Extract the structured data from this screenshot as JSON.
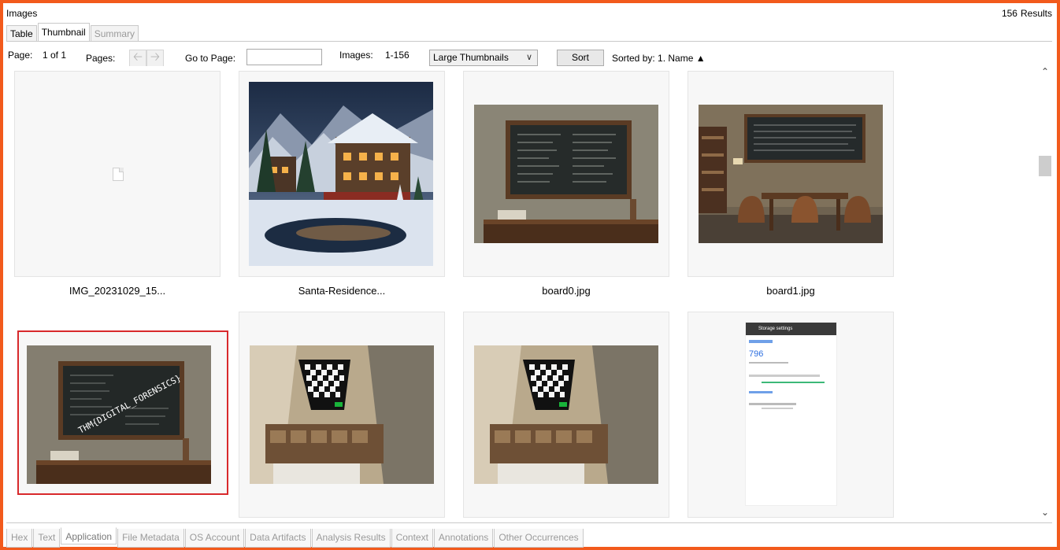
{
  "header": {
    "title": "Images",
    "results_count": "156",
    "results_label": "Results"
  },
  "top_tabs": [
    {
      "label": "Table",
      "state": "normal"
    },
    {
      "label": "Thumbnail",
      "state": "active"
    },
    {
      "label": "Summary",
      "state": "disabled"
    }
  ],
  "toolbar": {
    "page_label": "Page:",
    "page_value": "1 of 1",
    "pages_label": "Pages:",
    "goto_label": "Go to Page:",
    "goto_value": "",
    "images_label": "Images:",
    "images_value": "1-156",
    "size_option": "Large Thumbnails",
    "sort_button": "Sort",
    "sorted_by": "Sorted by: 1. Name ▲"
  },
  "thumbnails": [
    {
      "caption": "IMG_20231029_15...",
      "content": "blank-file-icon"
    },
    {
      "caption": "Santa-Residence...",
      "content": "winter-village-photo"
    },
    {
      "caption": "board0.jpg",
      "content": "chalkboard-photo"
    },
    {
      "caption": "board1.jpg",
      "content": "classroom-photo"
    },
    {
      "caption": "",
      "content": "chalkboard-photo-thm-digital-forensics",
      "selected": true
    },
    {
      "caption": "",
      "content": "ceiling-checkerboard-photo"
    },
    {
      "caption": "",
      "content": "ceiling-checkerboard-photo"
    },
    {
      "caption": "",
      "content": "phone-screenshot-storage-settings"
    }
  ],
  "image_texts": {
    "board_overlay": "THM{DIGITAL_FORENSICS}",
    "phone_title": "Storage settings",
    "phone_value": "796"
  },
  "bottom_tabs": [
    {
      "label": "Hex"
    },
    {
      "label": "Text"
    },
    {
      "label": "Application",
      "active": true
    },
    {
      "label": "File Metadata"
    },
    {
      "label": "OS Account"
    },
    {
      "label": "Data Artifacts"
    },
    {
      "label": "Analysis Results"
    },
    {
      "label": "Context"
    },
    {
      "label": "Annotations"
    },
    {
      "label": "Other Occurrences"
    }
  ],
  "colors": {
    "frame": "#f25a1c",
    "selection": "#d8292c"
  }
}
